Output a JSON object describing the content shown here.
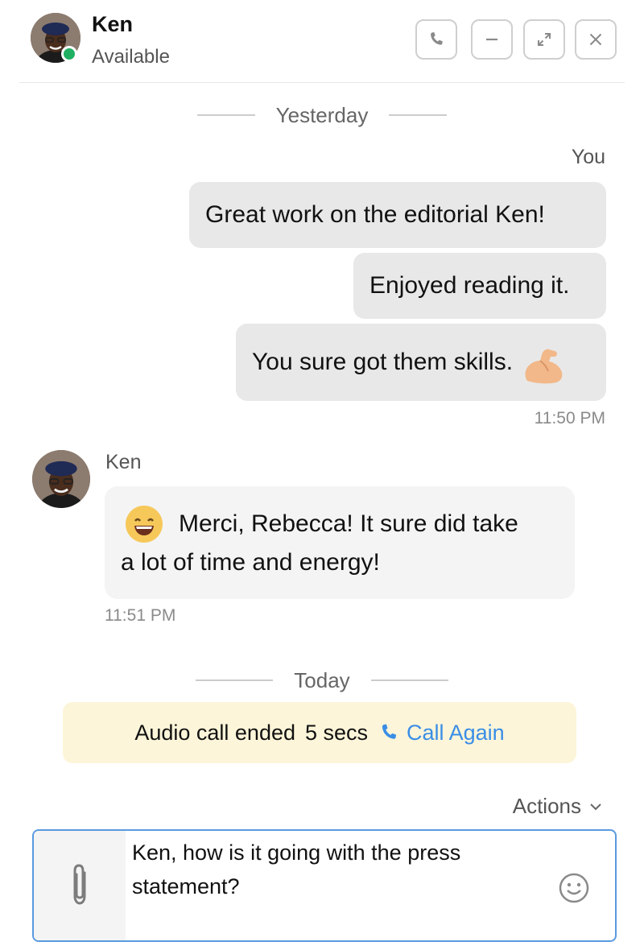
{
  "header": {
    "contact_name": "Ken",
    "status": "Available",
    "presence_color": "#20b062",
    "buttons": [
      {
        "name": "call-button",
        "icon": "phone-icon"
      },
      {
        "name": "minimize-button",
        "icon": "minus-icon"
      },
      {
        "name": "expand-button",
        "icon": "expand-icon"
      },
      {
        "name": "close-button",
        "icon": "close-icon"
      }
    ]
  },
  "conversation": {
    "yesterday_label": "Yesterday",
    "you_label": "You",
    "outgoing": [
      "Great work on the editorial Ken!",
      "Enjoyed reading it.",
      "You sure got them skills."
    ],
    "outgoing_emoji": "flexed-biceps-icon",
    "outgoing_time": "11:50 PM",
    "incoming_sender": "Ken",
    "incoming_line1": "Merci, Rebecca! It sure did take",
    "incoming_line2": "a lot of time and energy!",
    "incoming_emoji": "grinning-face-icon",
    "incoming_time": "11:51 PM",
    "today_label": "Today",
    "call_event": {
      "text": "Audio call ended",
      "duration": "5 secs",
      "action": "Call Again"
    }
  },
  "composer": {
    "actions_label": "Actions",
    "line1": "Ken, how is it going with the press",
    "line2": "statement?"
  },
  "colors": {
    "accent": "#3a8ee6",
    "bubble_out": "#e8e8e8",
    "bubble_in": "#f4f4f4",
    "call_banner": "#fdf5d9"
  }
}
